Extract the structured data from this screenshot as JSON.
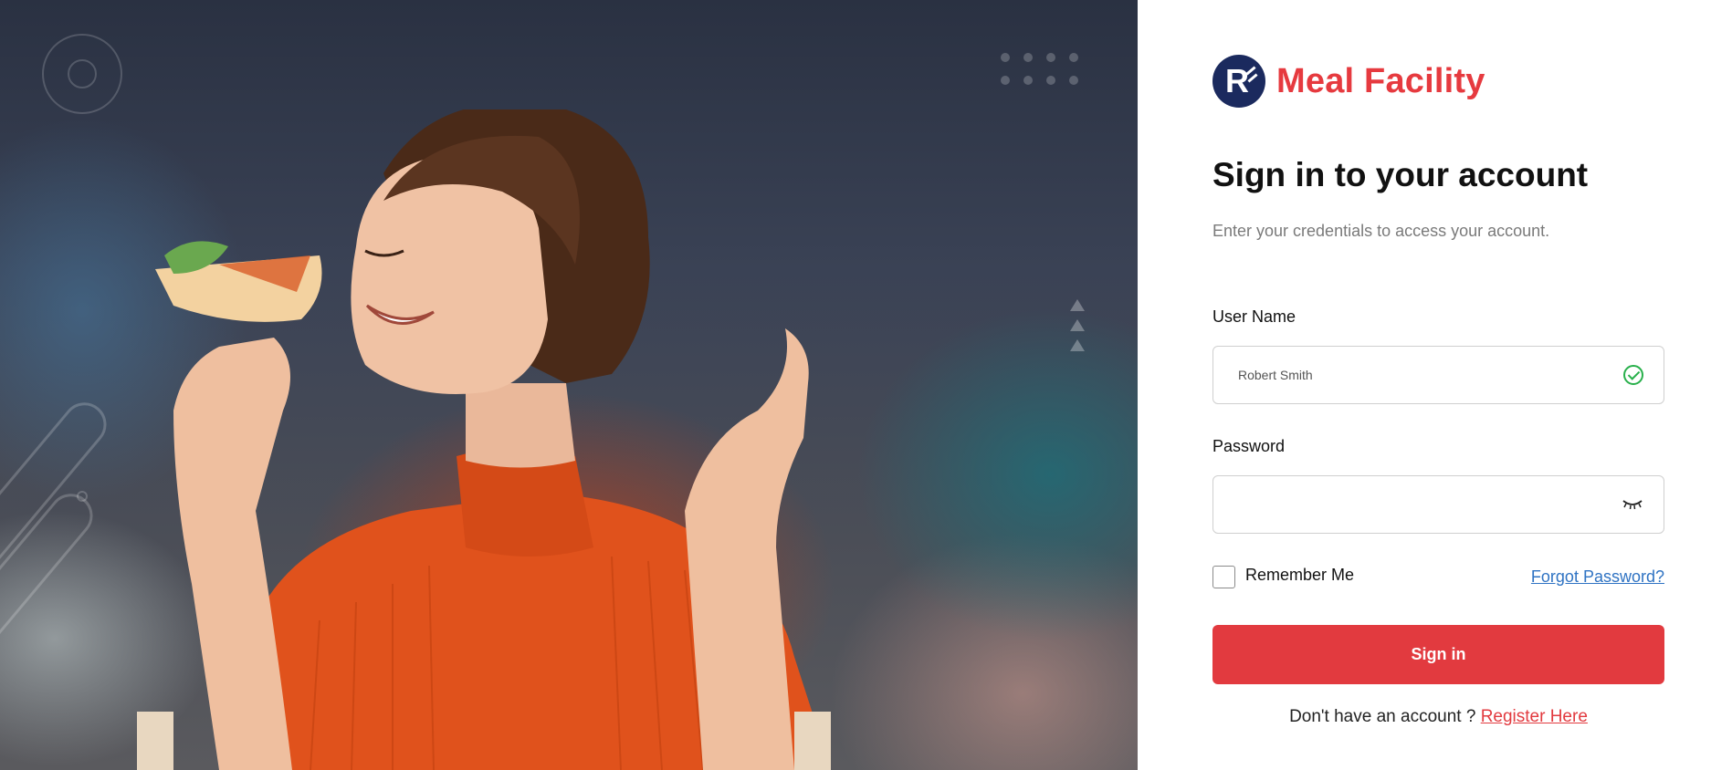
{
  "brand": {
    "name": "Meal Facility",
    "logo_icon": "brand-logo-icon",
    "accent_color": "#e63a3f",
    "logo_color": "#1b2a5e"
  },
  "form": {
    "heading": "Sign in to your account",
    "subheading": "Enter your credentials to access your account.",
    "username": {
      "label": "User Name",
      "value": "Robert Smith",
      "status_icon": "valid-check-icon",
      "status_color": "#28b04b"
    },
    "password": {
      "label": "Password",
      "value": "",
      "toggle_icon": "eye-closed-icon"
    },
    "remember_label": "Remember Me",
    "remember_checked": false,
    "forgot_label": "Forgot Password?",
    "submit_label": "Sign in",
    "register_prompt": "Don't have an account ? ",
    "register_link": "Register Here"
  },
  "colors": {
    "button": "#e23a3f",
    "link": "#2f73c3"
  }
}
